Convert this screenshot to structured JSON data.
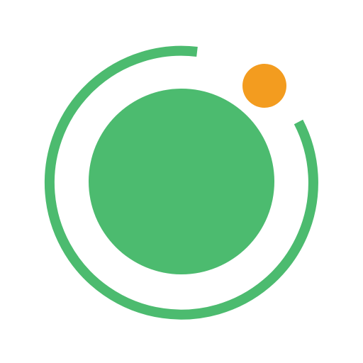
{
  "logo": {
    "icon": "orbit-logo-icon",
    "colors": {
      "primary_green": "#4CBB6F",
      "accent_orange": "#F39C1F",
      "background": "#FFFFFF"
    }
  }
}
